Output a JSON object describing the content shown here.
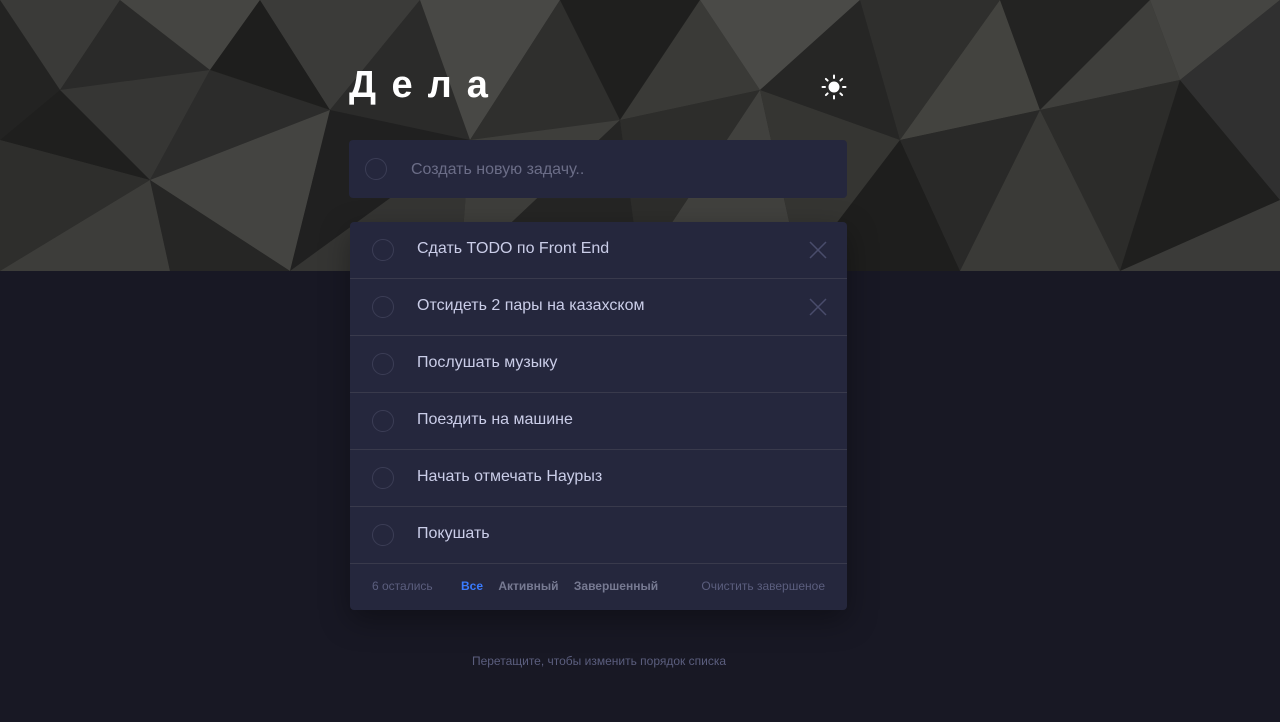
{
  "header": {
    "title": "Дела",
    "theme_toggle_icon": "sun-icon"
  },
  "new_todo": {
    "placeholder": "Создать новую задачу.."
  },
  "todos": [
    {
      "text": "Сдать TODO по Front End",
      "completed": false,
      "delete_visible": true
    },
    {
      "text": "Отсидеть 2 пары на казахском",
      "completed": false,
      "delete_visible": true
    },
    {
      "text": "Послушать музыку",
      "completed": false,
      "delete_visible": false
    },
    {
      "text": "Поездить на машине",
      "completed": false,
      "delete_visible": false
    },
    {
      "text": "Начать отмечать Наурыз",
      "completed": false,
      "delete_visible": false
    },
    {
      "text": "Покушать",
      "completed": false,
      "delete_visible": false
    }
  ],
  "footer": {
    "items_left": "6 остались",
    "filters": [
      "Все",
      "Активный",
      "Завершенный"
    ],
    "active_filter": "Все",
    "clear_label": "Очистить завершеное"
  },
  "hint": "Перетащите, чтобы изменить порядок списка",
  "colors": {
    "background": "#181824",
    "card": "#25273d",
    "text": "#cacde8",
    "muted": "#5b5e7e",
    "accent": "#3a7bfd",
    "divider": "#393a4c"
  }
}
